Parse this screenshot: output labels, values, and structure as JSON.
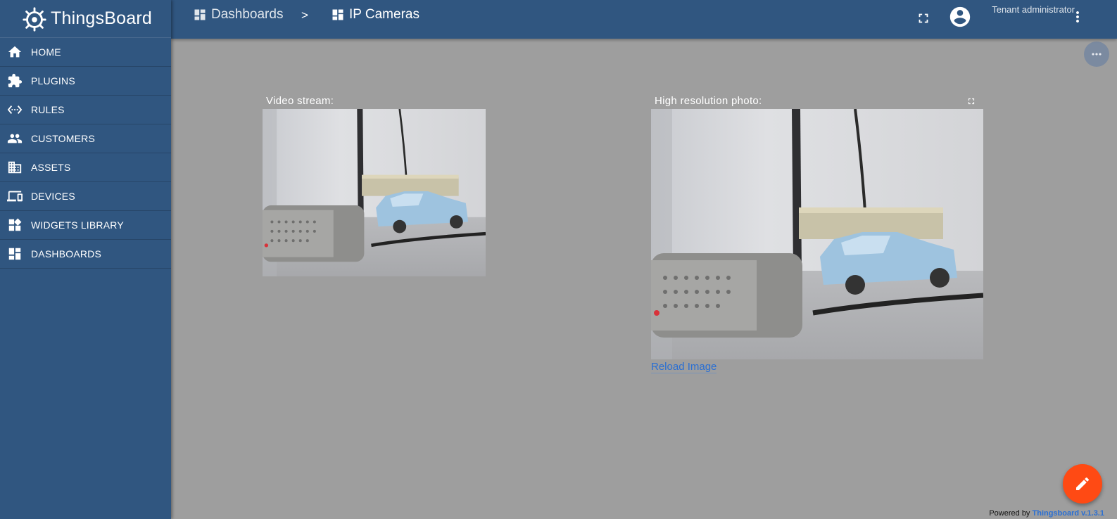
{
  "app": {
    "name": "ThingsBoard"
  },
  "sidebar": {
    "items": [
      {
        "label": "HOME",
        "icon": "home-icon"
      },
      {
        "label": "PLUGINS",
        "icon": "puzzle-icon"
      },
      {
        "label": "RULES",
        "icon": "settings-ethernet-icon"
      },
      {
        "label": "CUSTOMERS",
        "icon": "people-icon"
      },
      {
        "label": "ASSETS",
        "icon": "domain-icon"
      },
      {
        "label": "DEVICES",
        "icon": "devices-icon"
      },
      {
        "label": "WIDGETS LIBRARY",
        "icon": "widgets-icon"
      },
      {
        "label": "DASHBOARDS",
        "icon": "dashboard-icon"
      }
    ]
  },
  "header": {
    "breadcrumbs": [
      "Dashboards",
      "IP Cameras"
    ],
    "separator": ">",
    "user_role": "Tenant administrator"
  },
  "widgets": {
    "video": {
      "title": "Video stream:"
    },
    "photo": {
      "title": "High resolution photo:",
      "reload_label": "Reload Image"
    }
  },
  "footer": {
    "powered_prefix": "Powered by",
    "powered_link": "Thingsboard v.1.3.1"
  },
  "colors": {
    "primary": "#305680",
    "fab": "#ff4a14",
    "link": "#2a6fd3",
    "content_bg": "#9e9e9e"
  }
}
